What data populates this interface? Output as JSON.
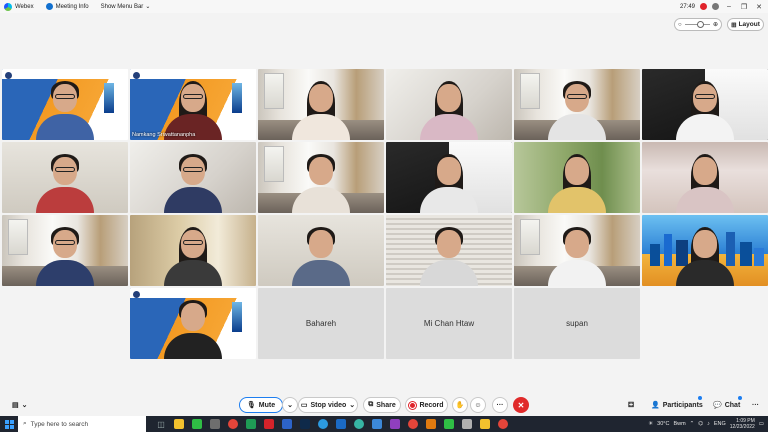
{
  "titlebar": {
    "app_name": "Webex",
    "meeting_info": "Meeting Info",
    "show_menu_bar": "Show Menu Bar",
    "time": "27:49"
  },
  "view": {
    "layout_label": "Layout"
  },
  "participants": {
    "tile_name_2": "Namkang Sriwattananpha",
    "blank_1": "Bahareh",
    "blank_2": "Mi Chan Htaw",
    "blank_3": "supan"
  },
  "controls": {
    "mute": "Mute",
    "stop_video": "Stop video",
    "share": "Share",
    "record": "Record",
    "more": "···",
    "participants": "Participants",
    "chat": "Chat"
  },
  "taskbar": {
    "search_placeholder": "Type here to search",
    "weather": "30°C",
    "weather_desc": "Bwm",
    "lang": "ENG",
    "time": "1:09 PM",
    "date": "12/23/2022"
  },
  "colors": {
    "accent": "#1d7ef0",
    "leave_red": "#e02a2a",
    "record_red": "#e0232a",
    "taskbar": "#1f2530"
  }
}
